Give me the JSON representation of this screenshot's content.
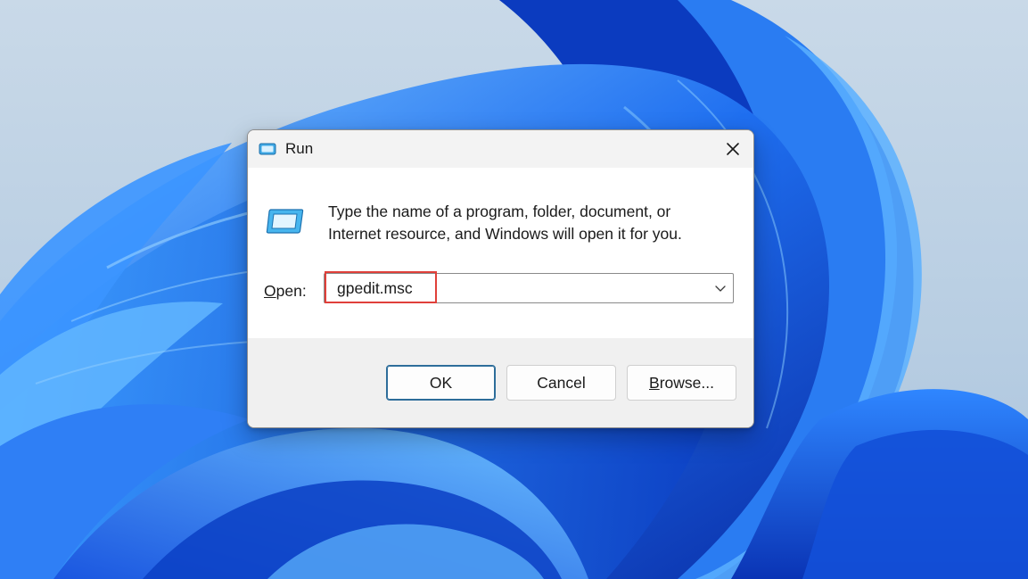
{
  "wallpaper": {
    "name": "Windows 11 bloom",
    "colors": {
      "sky": "#c9d9e8",
      "deep_blue": "#0b3fc4",
      "mid_blue": "#1f6ff0",
      "light_blue": "#58b4ff"
    }
  },
  "dialog": {
    "title": "Run",
    "title_icon": "run-app-icon",
    "close_icon": "close-icon",
    "description": "Type the name of a program, folder, document, or Internet resource, and Windows will open it for you.",
    "open_label_underlined": "O",
    "open_label_rest": "pen:",
    "open_input": {
      "value": "gpedit.msc",
      "placeholder": "",
      "dropdown_icon": "chevron-down-icon"
    },
    "highlight_color": "#e0403a",
    "buttons": {
      "ok": "OK",
      "cancel": "Cancel",
      "browse_underlined": "B",
      "browse_rest": "rowse..."
    },
    "accent_color": "#2d6d9a"
  }
}
